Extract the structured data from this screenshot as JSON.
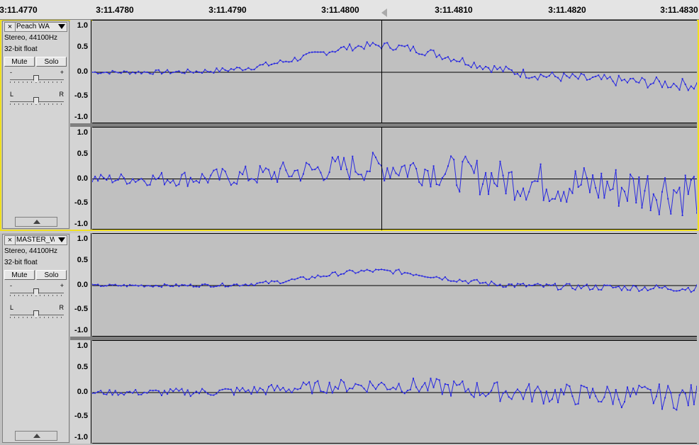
{
  "ruler": {
    "ticks": [
      "3:11.4770",
      "3:11.4780",
      "3:11.4790",
      "3:11.4800",
      "3:11.4810",
      "3:11.4820",
      "3:11.4830"
    ]
  },
  "tracks": [
    {
      "name": "Peach WA",
      "info_rate": "Stereo, 44100Hz",
      "info_format": "32-bit float",
      "mute_label": "Mute",
      "solo_label": "Solo",
      "gain_minus": "-",
      "gain_plus": "+",
      "pan_left": "L",
      "pan_right": "R",
      "close_glyph": "×",
      "selected": true
    },
    {
      "name": "MASTER_W",
      "info_rate": "Stereo, 44100Hz",
      "info_format": "32-bit float",
      "mute_label": "Mute",
      "solo_label": "Solo",
      "gain_minus": "-",
      "gain_plus": "+",
      "pan_left": "L",
      "pan_right": "R",
      "close_glyph": "×",
      "selected": false
    }
  ],
  "amplitude_labels": [
    "1.0",
    "0.5",
    "0.0",
    "-0.5",
    "-1.0"
  ],
  "colors": {
    "waveform": "#2a2ae0",
    "selection_border": "#f0e020",
    "background": "#c0c0c0"
  },
  "icons": {
    "close": "close-icon",
    "menu": "dropdown-arrow-icon",
    "collapse": "collapse-arrow-icon",
    "playhead": "playhead-marker-icon"
  }
}
